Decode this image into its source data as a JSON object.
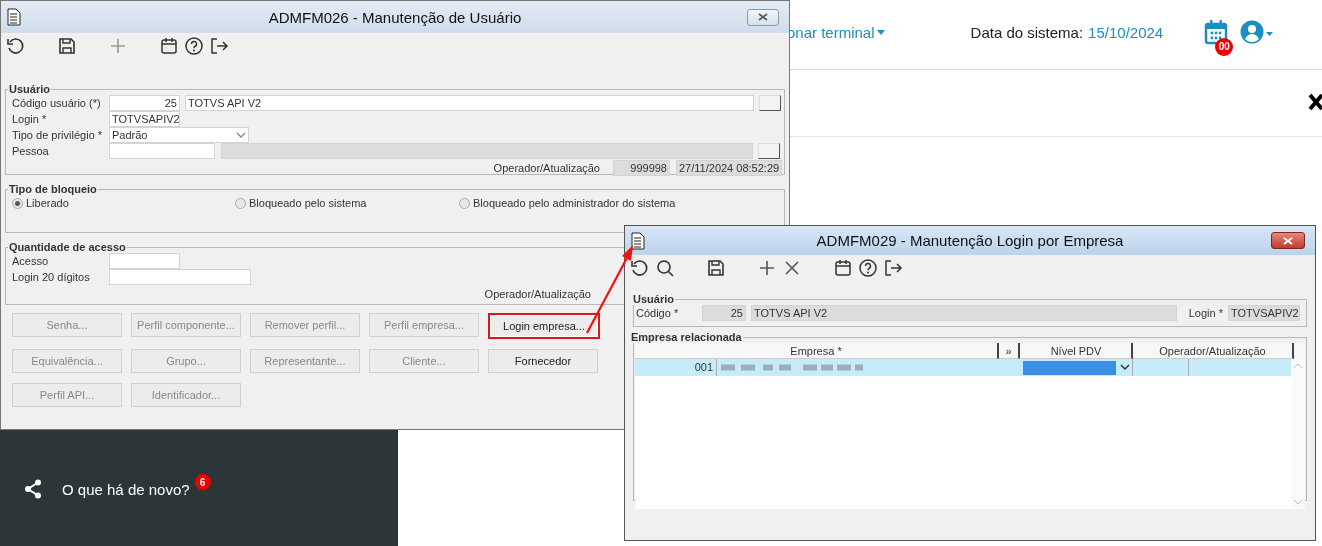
{
  "header": {
    "terminal_menu": "onar terminal",
    "date_label": "Data do sistema:",
    "date_value": "15/10/2024",
    "calendar_badge": "00"
  },
  "sidebar": {
    "items": [
      {
        "label": "O que há de novo?",
        "badge": "6"
      }
    ]
  },
  "user_window": {
    "title": "ADMFM026 - Manutenção de Usuário",
    "usuario": {
      "legend": "Usuário",
      "code_label": "Código usuário (*)",
      "code": "25",
      "name": "TOTVS API V2",
      "login_label": "Login *",
      "login": "TOTVSAPIV2",
      "privilege_label": "Tipo de privilégio *",
      "privilege": "Padrão",
      "person_label": "Pessoa",
      "operator_label": "Operador/Atualização",
      "operator": "999998",
      "updated": "27/11/2024 08:52:29"
    },
    "bloqueio": {
      "legend": "Tipo de bloqueio",
      "options": [
        {
          "label": "Liberado",
          "selected": true
        },
        {
          "label": "Bloqueado pelo sistema",
          "selected": false
        },
        {
          "label": "Bloqueado pelo administrador do sistema",
          "selected": false
        }
      ]
    },
    "acesso": {
      "legend": "Quantidade de acesso",
      "access_label": "Acesso",
      "login20_label": "Login 20 dígitos",
      "operator_label": "Operador/Atualização"
    },
    "buttons": [
      {
        "label": "Senha...",
        "disabled": true,
        "highlighted": false
      },
      {
        "label": "Perfil componente...",
        "disabled": true,
        "highlighted": false
      },
      {
        "label": "Remover perfil...",
        "disabled": true,
        "highlighted": false
      },
      {
        "label": "Perfil empresa...",
        "disabled": true,
        "highlighted": false
      },
      {
        "label": "Login empresa...",
        "disabled": false,
        "highlighted": true
      },
      {
        "label": "Equivalência...",
        "disabled": true,
        "highlighted": false
      },
      {
        "label": "Grupo...",
        "disabled": true,
        "highlighted": false
      },
      {
        "label": "Representante...",
        "disabled": true,
        "highlighted": false
      },
      {
        "label": "Cliente...",
        "disabled": true,
        "highlighted": false
      },
      {
        "label": "Fornecedor",
        "disabled": false,
        "highlighted": false
      },
      {
        "label": "Perfil API...",
        "disabled": true,
        "highlighted": false
      },
      {
        "label": "Identificador...",
        "disabled": true,
        "highlighted": false
      }
    ]
  },
  "login_window": {
    "title": "ADMFM029 - Manutenção Login por Empresa",
    "usuario": {
      "legend": "Usuário",
      "code_label": "Código *",
      "code": "25",
      "name": "TOTVS API V2",
      "login_label": "Login *",
      "login": "TOTVSAPIV2"
    },
    "grid": {
      "legend": "Empresa relacionada",
      "columns": [
        "Empresa *",
        "»",
        "Nível PDV",
        "Operador/Atualização"
      ],
      "rows": [
        {
          "code": "001",
          "selected": true
        }
      ]
    }
  }
}
